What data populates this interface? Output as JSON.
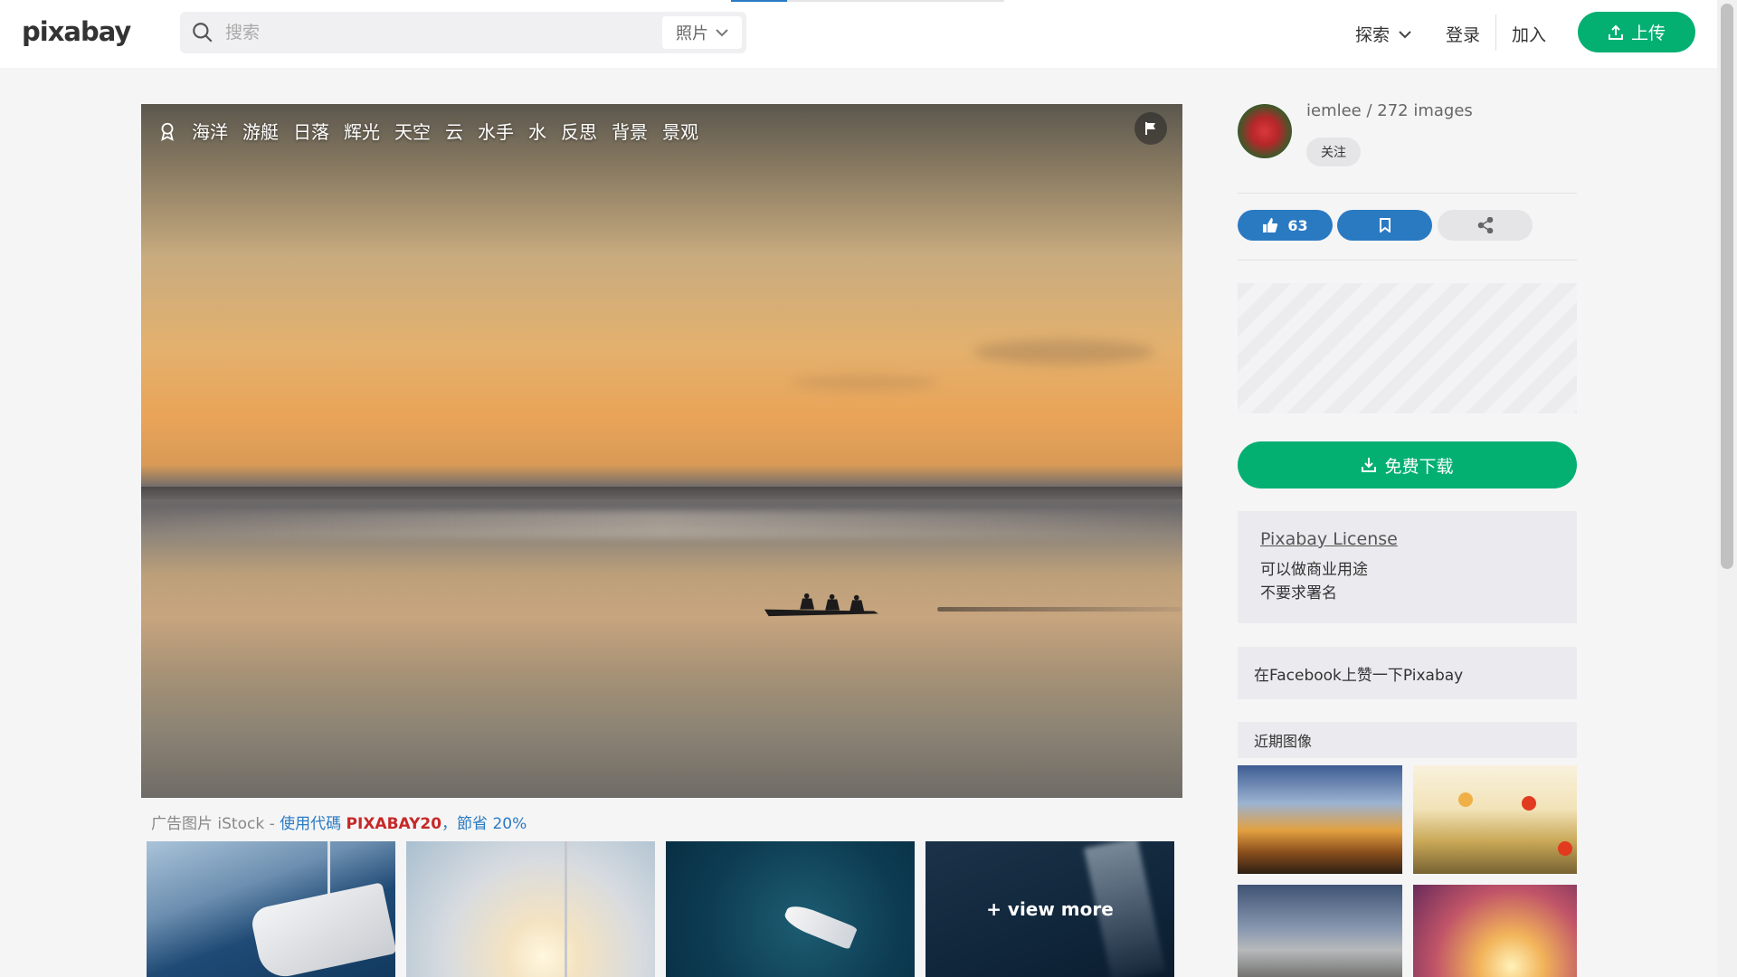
{
  "header": {
    "logo": "pixabay",
    "search": {
      "placeholder": "搜索",
      "type_label": "照片"
    },
    "nav": {
      "explore": "探索",
      "login": "登录",
      "join": "加入",
      "upload": "上传"
    }
  },
  "image": {
    "tags": [
      "海洋",
      "游艇",
      "日落",
      "辉光",
      "天空",
      "云",
      "水手",
      "水",
      "反思",
      "背景",
      "景观"
    ]
  },
  "ad": {
    "prefix": "广告图片 iStock - ",
    "use_code": "使用代碼 ",
    "code": "PIXABAY20",
    "save": "，節省 20%",
    "view_more": "+ view more"
  },
  "sidebar": {
    "user": "iemlee / 272 images",
    "follow": "关注",
    "likes": "63",
    "download": "免费下载",
    "license_title": "Pixabay License",
    "license_lines": [
      "可以做商业用途",
      "不要求署名"
    ],
    "facebook": "在Facebook上赞一下Pixabay",
    "recent_title": "近期图像"
  },
  "colors": {
    "brand_green": "#03b072",
    "accent_blue": "#2a7ac2",
    "code_red": "#c62828"
  },
  "icons": [
    "search-icon",
    "chevron-down-icon",
    "upload-icon",
    "award-icon",
    "flag-icon",
    "thumbs-up-icon",
    "bookmark-icon",
    "share-icon",
    "download-icon"
  ]
}
